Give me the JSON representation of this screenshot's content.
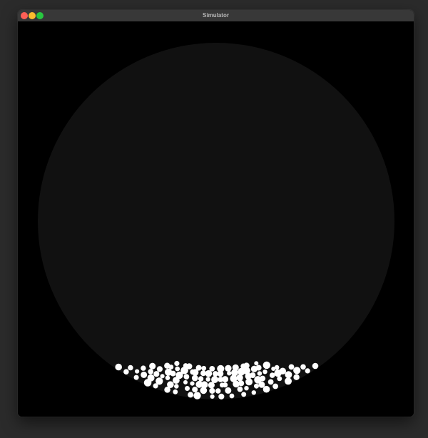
{
  "window": {
    "title": "Simulator",
    "controls": [
      "close",
      "minimize",
      "zoom"
    ]
  },
  "simulation": {
    "arena_shape": "circle",
    "colors": {
      "background": "#000000",
      "arena": "#111111",
      "particle": "#ffffff",
      "close_button": "#ff5f57",
      "minimize_button": "#febc2e",
      "zoom_button": "#28c840"
    }
  }
}
